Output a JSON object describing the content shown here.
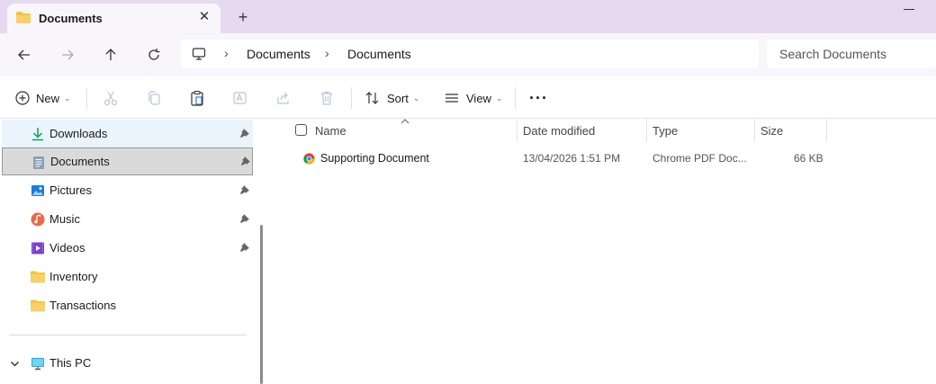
{
  "window": {
    "tab_title": "Documents",
    "tab_close": "✕",
    "new_tab": "+"
  },
  "address": {
    "crumbs": [
      "Documents",
      "Documents"
    ],
    "separator": "›",
    "search_placeholder": "Search Documents"
  },
  "toolbar": {
    "new_label": "New",
    "sort_label": "Sort",
    "view_label": "View",
    "more_label": "···"
  },
  "sidebar": {
    "items": [
      {
        "label": "Downloads",
        "icon": "download-icon",
        "pinned": true
      },
      {
        "label": "Documents",
        "icon": "documents-icon",
        "pinned": true
      },
      {
        "label": "Pictures",
        "icon": "pictures-icon",
        "pinned": true
      },
      {
        "label": "Music",
        "icon": "music-icon",
        "pinned": true
      },
      {
        "label": "Videos",
        "icon": "videos-icon",
        "pinned": true
      },
      {
        "label": "Inventory",
        "icon": "folder-icon",
        "pinned": false
      },
      {
        "label": "Transactions",
        "icon": "folder-icon",
        "pinned": false
      }
    ],
    "this_pc": "This PC"
  },
  "files": {
    "columns": [
      "Name",
      "Date modified",
      "Type",
      "Size"
    ],
    "rows": [
      {
        "name": "Supporting Document",
        "date": "13/04/2026 1:51 PM",
        "type": "Chrome PDF Doc...",
        "size": "66 KB"
      }
    ]
  },
  "colors": {
    "titlebar": "#e7d9ef",
    "selected": "#dadada",
    "accent": "#0067c0"
  }
}
